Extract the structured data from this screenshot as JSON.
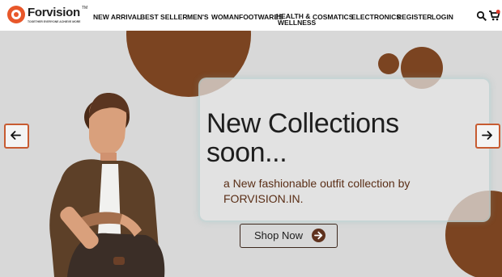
{
  "brand": {
    "name": "Forvision",
    "trademark": "TM",
    "tagline": "TOGETHER EVERYONE ACHIEVE MORE",
    "accent_color": "#e8572a"
  },
  "nav": [
    {
      "label": "NEW ARRIVAL"
    },
    {
      "label": "BEST SELLER"
    },
    {
      "label": "MEN'S"
    },
    {
      "label": "WOMAN"
    },
    {
      "label": "FOOTWARES"
    },
    {
      "label": "HEALTH &",
      "label2": "WELLNESS"
    },
    {
      "label": "COSMATICS"
    },
    {
      "label": "ELECTRONICS"
    },
    {
      "label": "REGISTER"
    },
    {
      "label": "LOGIN"
    }
  ],
  "icons": {
    "search": "search-icon",
    "cart": "cart-icon",
    "prev": "arrow-left-icon",
    "next": "arrow-right-icon"
  },
  "hero": {
    "title_line1": "New Collections",
    "title_line2": "soon...",
    "subtitle_line1": "a New fashionable outfit collection by",
    "subtitle_line2": "FORVISION.IN.",
    "button": "Shop Now",
    "brown_color": "#7b4421",
    "background_color": "#d8d8d8"
  }
}
